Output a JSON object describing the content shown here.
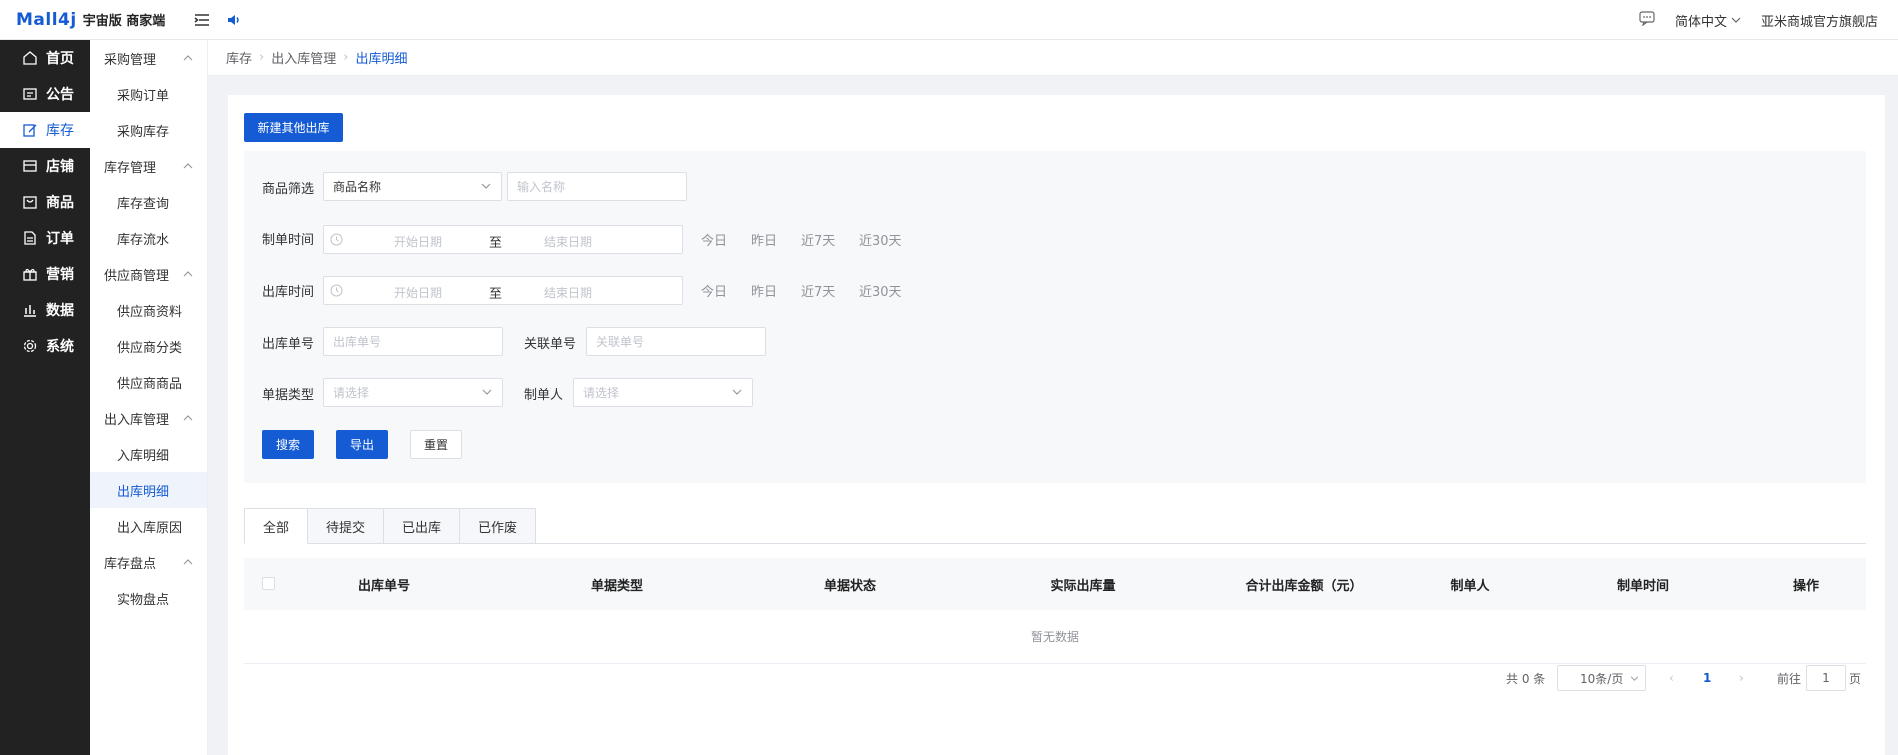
{
  "topbar": {
    "logo": "Mall4j",
    "edition": "宇宙版 商家端",
    "language": "简体中文",
    "shop_name": "亚米商城官方旗舰店"
  },
  "nav_main": [
    {
      "label": "首页",
      "icon": "home-icon"
    },
    {
      "label": "公告",
      "icon": "notice-icon"
    },
    {
      "label": "库存",
      "icon": "edit-icon",
      "active": true
    },
    {
      "label": "店铺",
      "icon": "store-icon"
    },
    {
      "label": "商品",
      "icon": "goods-icon"
    },
    {
      "label": "订单",
      "icon": "order-icon"
    },
    {
      "label": "营销",
      "icon": "gift-icon"
    },
    {
      "label": "数据",
      "icon": "chart-icon"
    },
    {
      "label": "系统",
      "icon": "gear-icon"
    }
  ],
  "nav_sub": [
    {
      "type": "group",
      "label": "采购管理"
    },
    {
      "type": "item",
      "label": "采购订单"
    },
    {
      "type": "item",
      "label": "采购库存"
    },
    {
      "type": "group",
      "label": "库存管理"
    },
    {
      "type": "item",
      "label": "库存查询"
    },
    {
      "type": "item",
      "label": "库存流水"
    },
    {
      "type": "group",
      "label": "供应商管理"
    },
    {
      "type": "item",
      "label": "供应商资料"
    },
    {
      "type": "item",
      "label": "供应商分类"
    },
    {
      "type": "item",
      "label": "供应商商品"
    },
    {
      "type": "group",
      "label": "出入库管理"
    },
    {
      "type": "item",
      "label": "入库明细"
    },
    {
      "type": "item",
      "label": "出库明细",
      "active": true
    },
    {
      "type": "item",
      "label": "出入库原因"
    },
    {
      "type": "group",
      "label": "库存盘点"
    },
    {
      "type": "item",
      "label": "实物盘点"
    }
  ],
  "breadcrumb": [
    "库存",
    "出入库管理",
    "出库明细"
  ],
  "new_button": "新建其他出库",
  "filters": {
    "goods_label": "商品筛选",
    "goods_select": "商品名称",
    "goods_placeholder": "输入名称",
    "create_time_label": "制单时间",
    "out_time_label": "出库时间",
    "start_placeholder": "开始日期",
    "range_sep": "至",
    "end_placeholder": "结束日期",
    "quick": [
      "今日",
      "昨日",
      "近7天",
      "近30天"
    ],
    "out_no_label": "出库单号",
    "out_no_placeholder": "出库单号",
    "rel_no_label": "关联单号",
    "rel_no_placeholder": "关联单号",
    "doc_type_label": "单据类型",
    "doc_type_placeholder": "请选择",
    "creator_label": "制单人",
    "creator_placeholder": "请选择",
    "search": "搜索",
    "export": "导出",
    "reset": "重置"
  },
  "tabs": [
    "全部",
    "待提交",
    "已出库",
    "已作废"
  ],
  "table": {
    "columns": [
      "出库单号",
      "单据类型",
      "单据状态",
      "实际出库量",
      "合计出库金额（元）",
      "制单人",
      "制单时间",
      "操作"
    ],
    "empty_text": "暂无数据"
  },
  "pagination": {
    "total": "共 0 条",
    "page_size": "10条/页",
    "current": "1",
    "goto_prefix": "前往",
    "goto_value": "1",
    "goto_suffix": "页"
  },
  "colors": {
    "accent": "#155bd4",
    "sidebar": "#222222"
  }
}
